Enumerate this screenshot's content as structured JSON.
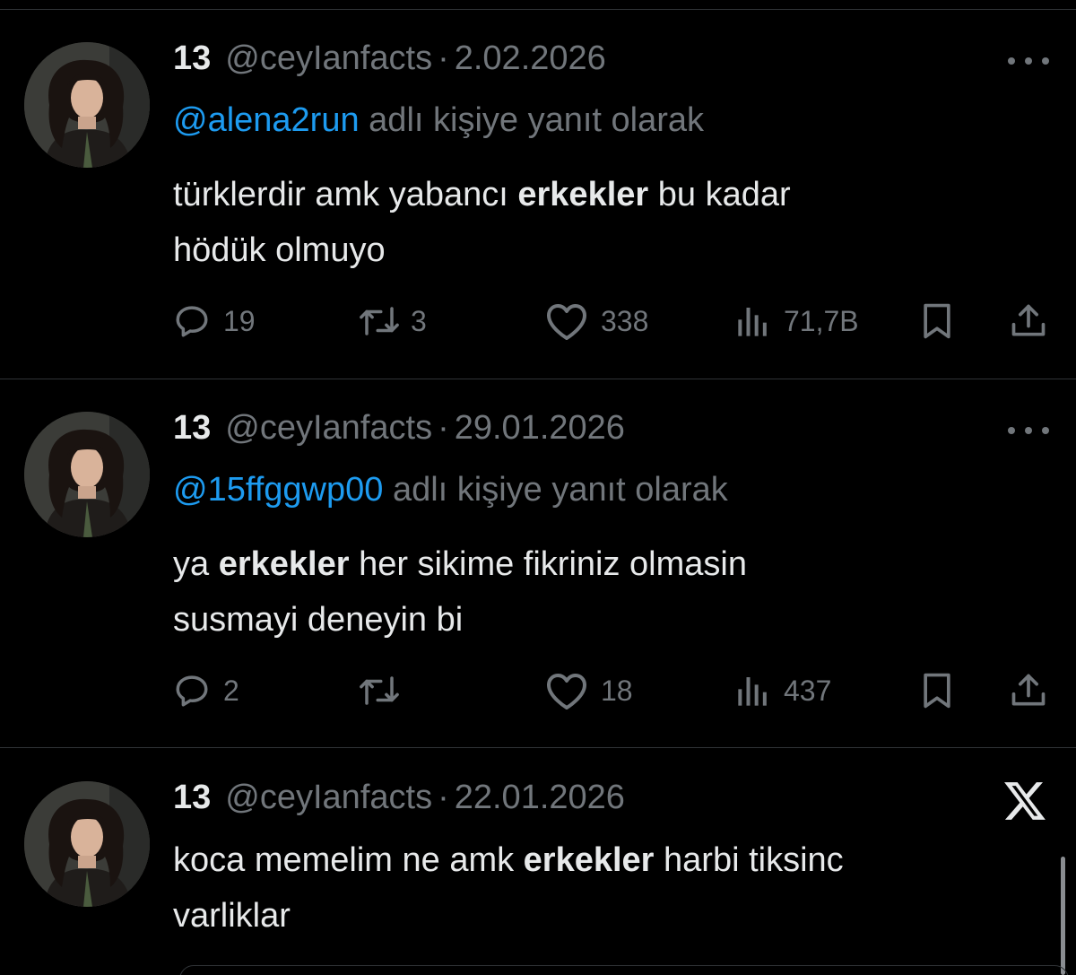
{
  "tweets": [
    {
      "name": "13",
      "handle": "@ceyIanfacts",
      "separator": "·",
      "date": "2.02.2026",
      "reply_mention": "@alena2run",
      "reply_suffix": "adlı kişiye yanıt olarak",
      "text_line1_a": "türklerdir amk yabancı ",
      "text_line1_bold": "erkekler",
      "text_line1_b": " bu kadar",
      "text_line2": "hödük olmuyo",
      "replies": "19",
      "reposts": "3",
      "likes": "338",
      "views": "71,7B"
    },
    {
      "name": "13",
      "handle": "@ceyIanfacts",
      "separator": "·",
      "date": "29.01.2026",
      "reply_mention": "@15ffggwp00",
      "reply_suffix": "adlı kişiye yanıt olarak",
      "text_line1_a": "ya ",
      "text_line1_bold": "erkekler",
      "text_line1_b": " her sikime fikriniz olmasin",
      "text_line2": "susmayi deneyin bi",
      "replies": "2",
      "reposts": "",
      "likes": "18",
      "views": "437"
    },
    {
      "name": "13",
      "handle": "@ceyIanfacts",
      "separator": "·",
      "date": "22.01.2026",
      "text_line1_a": "koca memelim ne amk ",
      "text_line1_bold": "erkekler",
      "text_line1_b": " harbi tiksinc",
      "text_line2": "varliklar"
    }
  ],
  "icons": {
    "reply": "reply-icon",
    "repost": "repost-icon",
    "like": "heart-icon",
    "views": "views-icon",
    "bookmark": "bookmark-icon",
    "share": "share-icon",
    "more": "more-icon",
    "brand": "x-logo-icon"
  },
  "colors": {
    "background": "#000000",
    "text": "#e7e9ea",
    "muted": "#71767b",
    "accent": "#1d9bf0",
    "divider": "#2f3336"
  }
}
